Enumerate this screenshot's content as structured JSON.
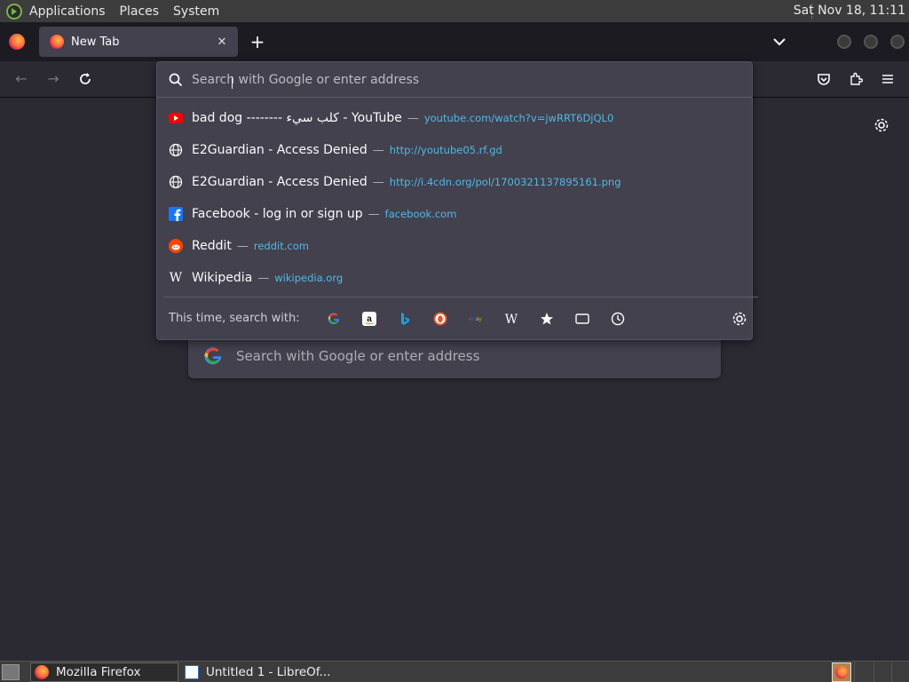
{
  "system_panel": {
    "menus": [
      "Applications",
      "Places",
      "System"
    ],
    "clock": "Sat Nov 18, 11:11"
  },
  "tabbar": {
    "tab_title": "New Tab",
    "close_glyph": "✕",
    "new_tab_glyph": "+"
  },
  "navbar": {
    "back_glyph": "←",
    "forward_glyph": "→"
  },
  "urlbar": {
    "placeholder": "Search with Google or enter address",
    "results": [
      {
        "icon": "youtube-icon",
        "title": "bad dog -------- كلب سيء - YouTube",
        "url": "youtube.com/watch?v=jwRRT6DjQL0"
      },
      {
        "icon": "globe-icon",
        "title": "E2Guardian - Access Denied",
        "url": "http://youtube05.rf.gd"
      },
      {
        "icon": "globe-icon",
        "title": "E2Guardian - Access Denied",
        "url": "http://i.4cdn.org/pol/1700321137895161.png"
      },
      {
        "icon": "facebook-icon",
        "title": "Facebook - log in or sign up",
        "url": "facebook.com"
      },
      {
        "icon": "reddit-icon",
        "title": "Reddit",
        "url": "reddit.com"
      },
      {
        "icon": "wikipedia-icon",
        "title": "Wikipedia",
        "url": "wikipedia.org"
      }
    ],
    "dash": "—",
    "oneoff_label": "This time, search with:",
    "engines": [
      "google-icon",
      "amazon-icon",
      "bing-icon",
      "duckduckgo-icon",
      "ebay-icon",
      "wikipedia-icon",
      "bookmarks-icon",
      "tabs-icon",
      "history-icon"
    ]
  },
  "newtab": {
    "search_placeholder": "Search with Google or enter address"
  },
  "taskbar": {
    "tasks": [
      "Mozilla Firefox",
      "Untitled 1 - LibreOf..."
    ]
  },
  "colors": {
    "accent_url": "#52b8e6",
    "page_bg": "#2b2a33",
    "popup_bg": "#42414d",
    "youtube_red": "#ff0000",
    "facebook_blue": "#1877f2",
    "reddit_orange": "#ff4500"
  }
}
